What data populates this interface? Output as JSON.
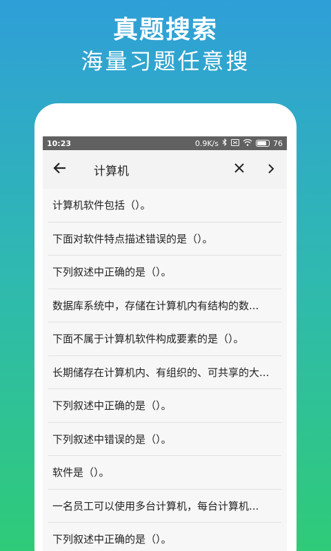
{
  "promo": {
    "title": "真题搜索",
    "subtitle": "海量习题任意搜"
  },
  "status_bar": {
    "time": "10:23",
    "speed": "0.9K/s",
    "battery": "76"
  },
  "toolbar": {
    "back_icon": "arrow-left-icon",
    "query": "计算机",
    "clear_icon": "close-icon",
    "next_icon": "chevron-right-icon"
  },
  "results": [
    "计算机软件包括（）。",
    "下面对软件特点描述错误的是（）。",
    "下列叙述中正确的是（）。",
    "数据库系统中，存储在计算机内有结构的数...",
    "下面不属于计算机软件构成要素的是（）。",
    "长期储存在计算机内、有组织的、可共享的大...",
    "下列叙述中正确的是（）。",
    "下列叙述中错误的是（）。",
    "软件是（）。",
    "一名员工可以使用多台计算机，每台计算机...",
    "下列叙述中正确的是（）。"
  ]
}
